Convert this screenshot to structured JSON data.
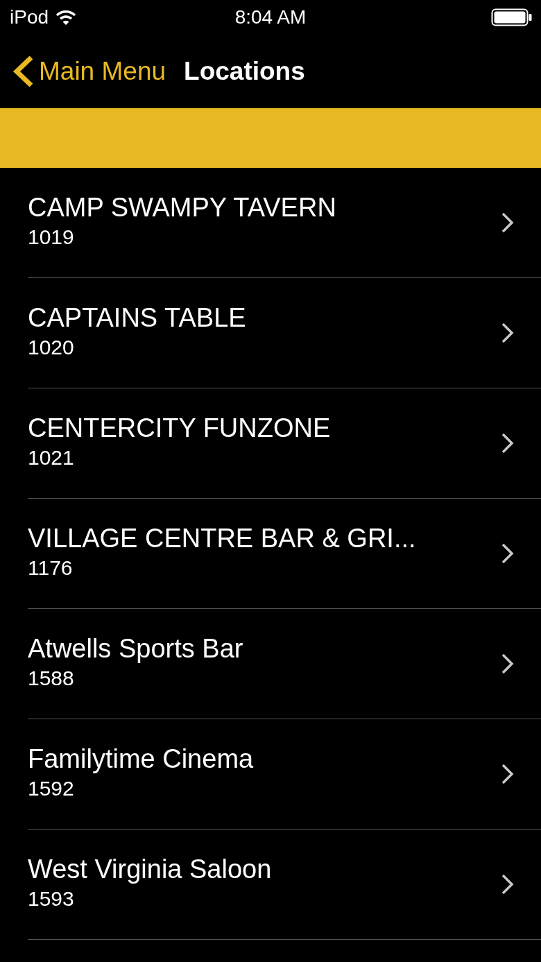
{
  "status_bar": {
    "carrier": "iPod",
    "time": "8:04 AM"
  },
  "nav_bar": {
    "back_label": "Main Menu",
    "title": "Locations"
  },
  "locations": [
    {
      "name": "CAMP SWAMPY TAVERN",
      "code": "1019"
    },
    {
      "name": "CAPTAINS TABLE",
      "code": "1020"
    },
    {
      "name": "CENTERCITY FUNZONE",
      "code": "1021"
    },
    {
      "name": "VILLAGE CENTRE BAR & GRI...",
      "code": "1176"
    },
    {
      "name": "Atwells Sports Bar",
      "code": "1588"
    },
    {
      "name": "Familytime Cinema",
      "code": "1592"
    },
    {
      "name": "West Virginia Saloon",
      "code": "1593"
    }
  ]
}
